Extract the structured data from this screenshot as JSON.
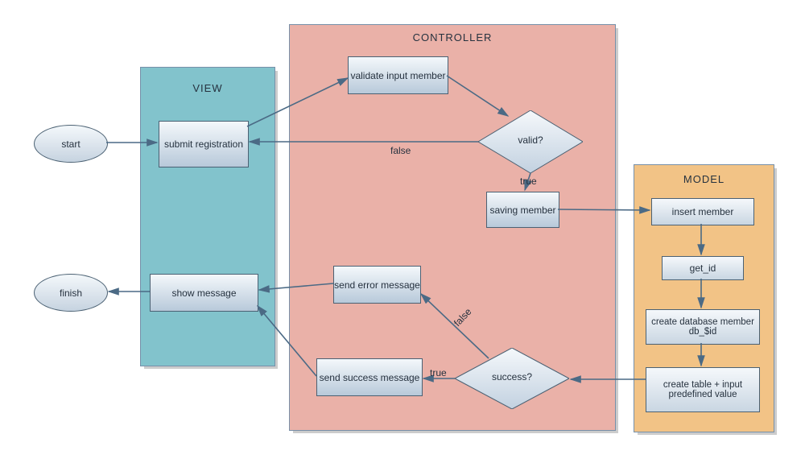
{
  "panels": {
    "view": {
      "label": "VIEW"
    },
    "controller": {
      "label": "CONTROLLER"
    },
    "model": {
      "label": "MODEL"
    }
  },
  "nodes": {
    "start": "start",
    "finish": "finish",
    "submit": "submit registration",
    "showmsg": "show message",
    "validate": "validate input member",
    "senderr": "send error message",
    "sendok": "send success message",
    "valid": "valid?",
    "saving": "saving member",
    "success": "success?",
    "insert": "insert member",
    "getid": "get_id",
    "createdb": "create database member db_$id",
    "createtbl": "create table + input predefined value"
  },
  "edges": {
    "false1": "false",
    "true1": "true",
    "false2": "false",
    "true2": "true"
  }
}
